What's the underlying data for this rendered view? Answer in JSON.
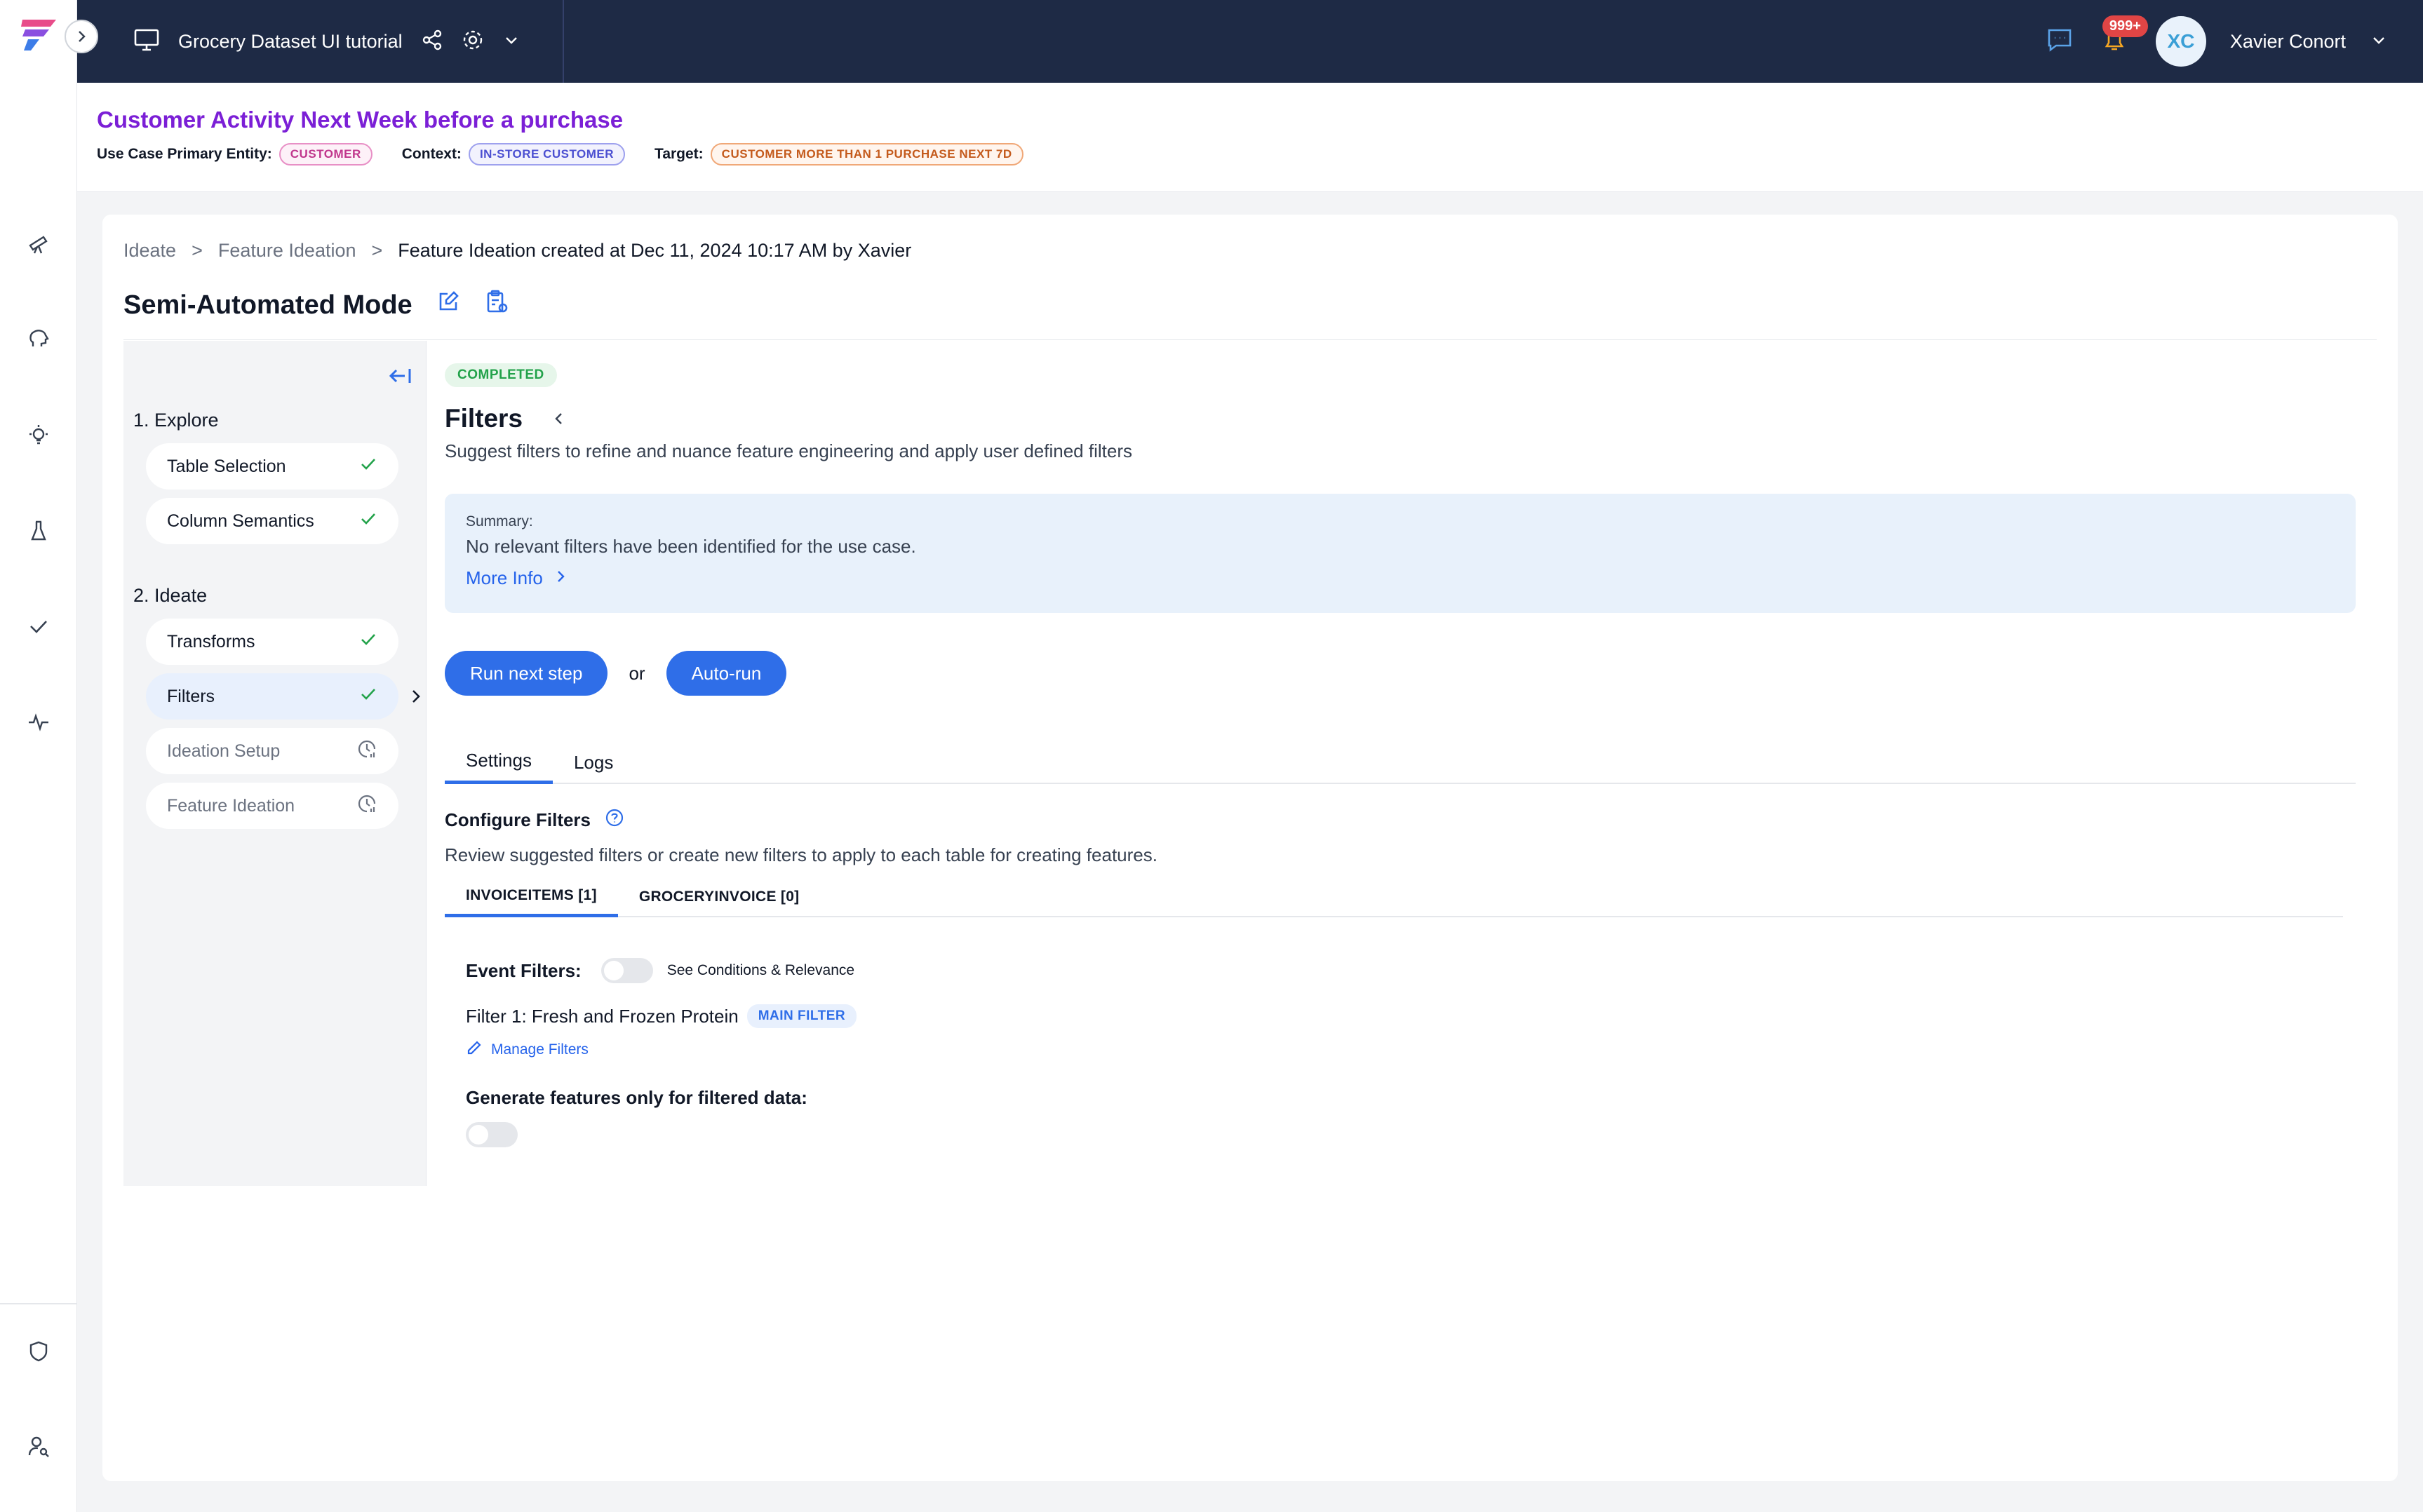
{
  "topbar": {
    "project_title": "Grocery Dataset UI tutorial",
    "notification_count": "999+",
    "user_initials": "XC",
    "user_name": "Xavier Conort"
  },
  "use_case": {
    "title": "Customer Activity Next Week before a purchase",
    "entity_label": "Use Case Primary Entity:",
    "entity_value": "CUSTOMER",
    "context_label": "Context:",
    "context_value": "IN-STORE CUSTOMER",
    "target_label": "Target:",
    "target_value": "CUSTOMER MORE THAN 1 PURCHASE NEXT 7D"
  },
  "breadcrumb": {
    "items": [
      "Ideate",
      "Feature Ideation",
      "Feature Ideation created at Dec 11, 2024 10:17 AM by Xavier"
    ],
    "separator": ">"
  },
  "mode_title": "Semi-Automated Mode",
  "steps": {
    "sections": [
      {
        "label": "1. Explore",
        "items": [
          "Table Selection",
          "Column Semantics"
        ]
      },
      {
        "label": "2. Ideate",
        "items": [
          "Transforms",
          "Filters",
          "Ideation Setup",
          "Feature Ideation"
        ]
      }
    ]
  },
  "filters": {
    "status": "COMPLETED",
    "title": "Filters",
    "subtitle": "Suggest filters to refine and nuance feature engineering and apply user defined filters",
    "summary_label": "Summary:",
    "summary_text": "No relevant filters have been identified for the use case.",
    "more_info": "More Info",
    "run_next": "Run next step",
    "or": "or",
    "auto_run": "Auto-run",
    "tabs": [
      "Settings",
      "Logs"
    ],
    "configure_title": "Configure Filters",
    "configure_sub": "Review suggested filters or create new filters to apply to each table for creating features.",
    "table_tabs": [
      "INVOICEITEMS [1]",
      "GROCERYINVOICE [0]"
    ],
    "event_filters_label": "Event Filters:",
    "see_conditions": "See Conditions & Relevance",
    "filter_1": "Filter 1: Fresh and Frozen Protein",
    "main_filter_badge": "MAIN FILTER",
    "manage_filters": "Manage Filters",
    "generate_label": "Generate features only for filtered data:"
  },
  "colors": {
    "topbar": "#1e2a45",
    "accent": "#2f6ee8",
    "usecase_title": "#7b1fd6",
    "completed": "#22a24a"
  }
}
